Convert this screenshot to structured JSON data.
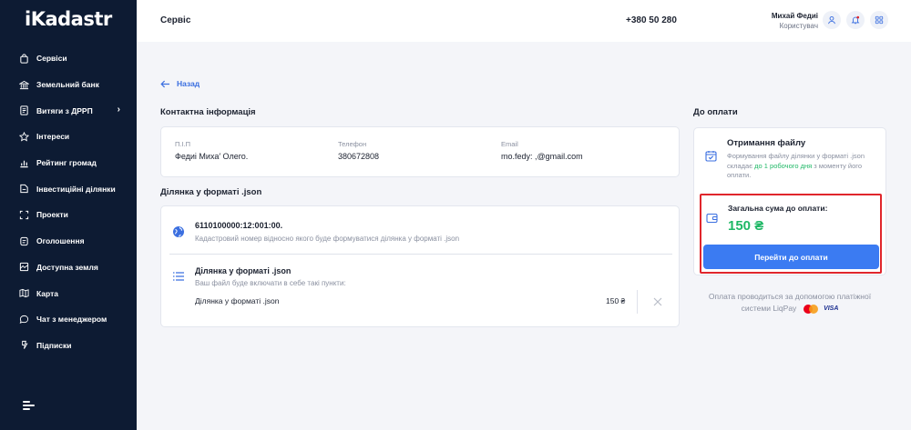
{
  "brand": {
    "logo": "iKadastr"
  },
  "sidebar": {
    "items": [
      {
        "label": "Сервіси",
        "icon": "shopping-bag-icon"
      },
      {
        "label": "Земельний банк",
        "icon": "bank-icon"
      },
      {
        "label": "Витяги з ДРРП",
        "icon": "document-icon",
        "chevron": "›"
      },
      {
        "label": "Інтереси",
        "icon": "star-icon"
      },
      {
        "label": "Рейтинг громад",
        "icon": "chart-icon"
      },
      {
        "label": "Інвестиційні ділянки",
        "icon": "plot-icon"
      },
      {
        "label": "Проекти",
        "icon": "frame-icon"
      },
      {
        "label": "Оголошення",
        "icon": "announcement-icon"
      },
      {
        "label": "Доступна земля",
        "icon": "land-icon"
      },
      {
        "label": "Карта",
        "icon": "map-icon"
      },
      {
        "label": "Чат з менеджером",
        "icon": "chat-icon"
      },
      {
        "label": "Підписки",
        "icon": "subscription-icon"
      }
    ]
  },
  "header": {
    "title": "Сервіс",
    "phone": "+380 50 280",
    "user_name": "Михай    Федиі",
    "user_role": "Користувач"
  },
  "back_label": "Назад",
  "contact": {
    "section_title": "Контактна інформація",
    "fields": [
      {
        "label": "П.І.П",
        "value": "Федиі     Миха′    Олего."
      },
      {
        "label": "Телефон",
        "value": "380672808"
      },
      {
        "label": "Email",
        "value": "mo.fedy:    ,@gmail.com"
      }
    ]
  },
  "plot": {
    "section_title": "Ділянка у форматі .json",
    "cadastral_number": "6110100000:12:001:00.",
    "cadastral_hint": "Кадастровий номер відносно якого буде формуватися ділянка у форматі .json",
    "file_title": "Ділянка у форматі .json",
    "file_hint": "Ваш файл буде включати в себе такі пункти:",
    "line_item": {
      "label": "Ділянка у форматі .json",
      "price": "150 ₴"
    }
  },
  "payment": {
    "section_title": "До оплати",
    "receive_title": "Отримання файлу",
    "receive_text_1": "Формування файлу ділянки у форматі .json",
    "receive_text_2a": "складає",
    "receive_text_2b": "до 1 робочого дня",
    "receive_text_2c": "з моменту його",
    "receive_text_3": "оплати.",
    "total_label": "Загальна сума до оплати:",
    "total_value": "150 ₴",
    "pay_button": "Перейти до оплати",
    "note_1": "Оплата проводиться за допомогою платіжної",
    "note_2": "системи LiqPay",
    "visa": "VISA"
  },
  "colors": {
    "sidebar": "#0d1b33",
    "accent": "#3b7bf2",
    "success": "#1fb866",
    "highlight": "#e0262c"
  }
}
